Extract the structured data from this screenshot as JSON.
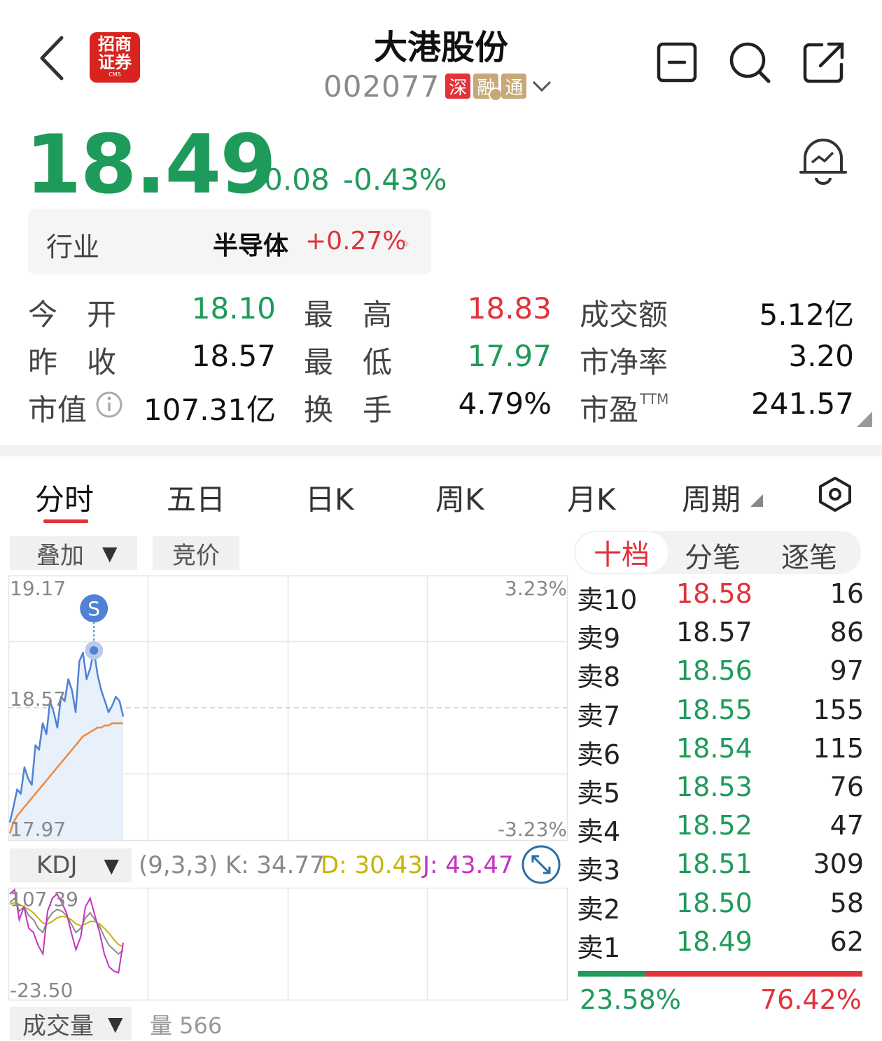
{
  "header": {
    "stock_name": "大港股份",
    "stock_code": "002077",
    "logo_line1": "招商",
    "logo_line2": "证券",
    "logo_line3": "CMS",
    "tags": [
      "深",
      "融",
      "通"
    ]
  },
  "quote": {
    "price": "18.49",
    "change": "-0.08",
    "change_pct": "-0.43%"
  },
  "industry": {
    "label": "行业",
    "name": "半导体",
    "change_pct": "+0.27%"
  },
  "stats": [
    {
      "label": "今　开",
      "value": "18.10",
      "color": "green"
    },
    {
      "label": "最　高",
      "value": "18.83",
      "color": "red"
    },
    {
      "label": "成交额",
      "value": "5.12亿",
      "color": "black"
    },
    {
      "label": "昨　收",
      "value": "18.57",
      "color": "black"
    },
    {
      "label": "最　低",
      "value": "17.97",
      "color": "green"
    },
    {
      "label": "市净率",
      "value": "3.20",
      "color": "black"
    },
    {
      "label": "市值",
      "value": "107.31亿",
      "color": "black"
    },
    {
      "label": "换　手",
      "value": "4.79%",
      "color": "black"
    },
    {
      "label": "市盈",
      "value": "241.57",
      "color": "black",
      "suffix": "TTM"
    }
  ],
  "chart_tabs": [
    "分时",
    "五日",
    "日K",
    "周K",
    "月K",
    "周期"
  ],
  "chart_controls": {
    "overlay": "叠加",
    "auction": "竞价"
  },
  "chart_data": {
    "type": "line",
    "title": "",
    "y_left_ticks": [
      "19.17",
      "18.57",
      "17.97"
    ],
    "y_right_ticks": [
      "3.23%",
      "-3.23%"
    ],
    "ylim": [
      17.97,
      19.17
    ],
    "prev_close": 18.57,
    "marker": "S",
    "series": [
      {
        "values": [
          18.05,
          18.12,
          18.2,
          18.18,
          18.3,
          18.25,
          18.22,
          18.4,
          18.38,
          18.5,
          18.45,
          18.6,
          18.55,
          18.48,
          18.62,
          18.6,
          18.7,
          18.65,
          18.55,
          18.78,
          18.82,
          18.7,
          18.75,
          18.83,
          18.72,
          18.65,
          18.6,
          18.55,
          18.58,
          18.62,
          18.6,
          18.53
        ]
      },
      {
        "values": [
          18.0,
          18.05,
          18.08,
          18.1,
          18.12,
          18.14,
          18.16,
          18.18,
          18.2,
          18.22,
          18.24,
          18.26,
          18.28,
          18.3,
          18.32,
          18.34,
          18.36,
          18.38,
          18.4,
          18.42,
          18.44,
          18.45,
          18.46,
          18.47,
          18.48,
          18.48,
          18.49,
          18.49,
          18.5,
          18.5,
          18.5,
          18.5
        ]
      }
    ]
  },
  "kdj": {
    "label": "KDJ",
    "params": "(9,3,3)",
    "k": "K: 34.77",
    "d": "D: 30.43",
    "j": "J: 43.47",
    "y_ticks": [
      "107.39",
      "-23.50"
    ],
    "k_values": [
      90,
      95,
      80,
      85,
      75,
      70,
      60,
      55,
      70,
      78,
      82,
      80,
      75,
      65,
      55,
      60,
      72,
      78,
      70,
      62,
      50,
      40,
      35,
      30,
      34
    ],
    "d_values": [
      88,
      90,
      88,
      85,
      82,
      78,
      72,
      66,
      65,
      68,
      72,
      74,
      73,
      70,
      65,
      63,
      65,
      68,
      68,
      65,
      60,
      54,
      47,
      41,
      38
    ],
    "j_values": [
      100,
      105,
      70,
      85,
      60,
      55,
      40,
      30,
      80,
      95,
      100,
      90,
      78,
      55,
      35,
      50,
      85,
      95,
      75,
      55,
      30,
      15,
      10,
      8,
      43
    ]
  },
  "order_book": {
    "tabs": [
      "十档",
      "分笔",
      "逐笔"
    ],
    "rows": [
      {
        "label": "卖10",
        "price": "18.58",
        "vol": "16",
        "color": "red"
      },
      {
        "label": "卖9",
        "price": "18.57",
        "vol": "86",
        "color": "black"
      },
      {
        "label": "卖8",
        "price": "18.56",
        "vol": "97",
        "color": "green"
      },
      {
        "label": "卖7",
        "price": "18.55",
        "vol": "155",
        "color": "green"
      },
      {
        "label": "卖6",
        "price": "18.54",
        "vol": "115",
        "color": "green"
      },
      {
        "label": "卖5",
        "price": "18.53",
        "vol": "76",
        "color": "green"
      },
      {
        "label": "卖4",
        "price": "18.52",
        "vol": "47",
        "color": "green"
      },
      {
        "label": "卖3",
        "price": "18.51",
        "vol": "309",
        "color": "green"
      },
      {
        "label": "卖2",
        "price": "18.50",
        "vol": "58",
        "color": "green"
      },
      {
        "label": "卖1",
        "price": "18.49",
        "vol": "62",
        "color": "green"
      }
    ],
    "buy_ratio": "23.58%",
    "sell_ratio": "76.42%",
    "buy_fraction": 0.2358
  },
  "volume": {
    "label": "成交量",
    "text": "量 566"
  }
}
